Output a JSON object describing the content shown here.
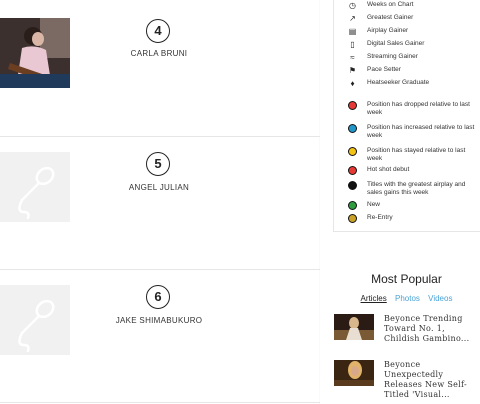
{
  "chart_rows": [
    {
      "rank": "4",
      "artist": "CARLA BRUNI",
      "image": "photo"
    },
    {
      "rank": "5",
      "artist": "ANGEL JULIAN",
      "image": "microphone-placeholder"
    },
    {
      "rank": "6",
      "artist": "JAKE SHIMABUKURO",
      "image": "microphone-placeholder"
    }
  ],
  "legend": {
    "icon_items": [
      {
        "icon": "clock-icon",
        "label": "Weeks on Chart"
      },
      {
        "icon": "trend-up-icon",
        "label": "Greatest Gainer"
      },
      {
        "icon": "radio-icon",
        "label": "Airplay Gainer"
      },
      {
        "icon": "phone-icon",
        "label": "Digital Sales Gainer"
      },
      {
        "icon": "wifi-icon",
        "label": "Streaming Gainer"
      },
      {
        "icon": "flag-icon",
        "label": "Pace Setter"
      },
      {
        "icon": "flame-icon",
        "label": "Heatseeker Graduate"
      }
    ],
    "dot_items": [
      {
        "color": "#e53935",
        "label": "Position has dropped relative to last week"
      },
      {
        "color": "#2196c9",
        "label": "Position has increased relative to last week"
      },
      {
        "color": "#f2c314",
        "label": "Position has stayed relative to last week"
      },
      {
        "color": "#e53935",
        "label": "Hot shot debut"
      },
      {
        "color": "#111111",
        "label": "Titles with the greatest airplay and sales gains this week"
      },
      {
        "color": "#2e9b3f",
        "label": "New"
      },
      {
        "color": "#c9a227",
        "label": "Re-Entry"
      }
    ]
  },
  "most_popular": {
    "title": "Most Popular",
    "tabs": [
      "Articles",
      "Photos",
      "Videos"
    ],
    "articles": [
      {
        "title": "Beyonce Trending Toward No. 1, Childish Gambino..."
      },
      {
        "title": "Beyonce Unexpectedly Releases New Self-Titled 'Visual..."
      }
    ]
  }
}
